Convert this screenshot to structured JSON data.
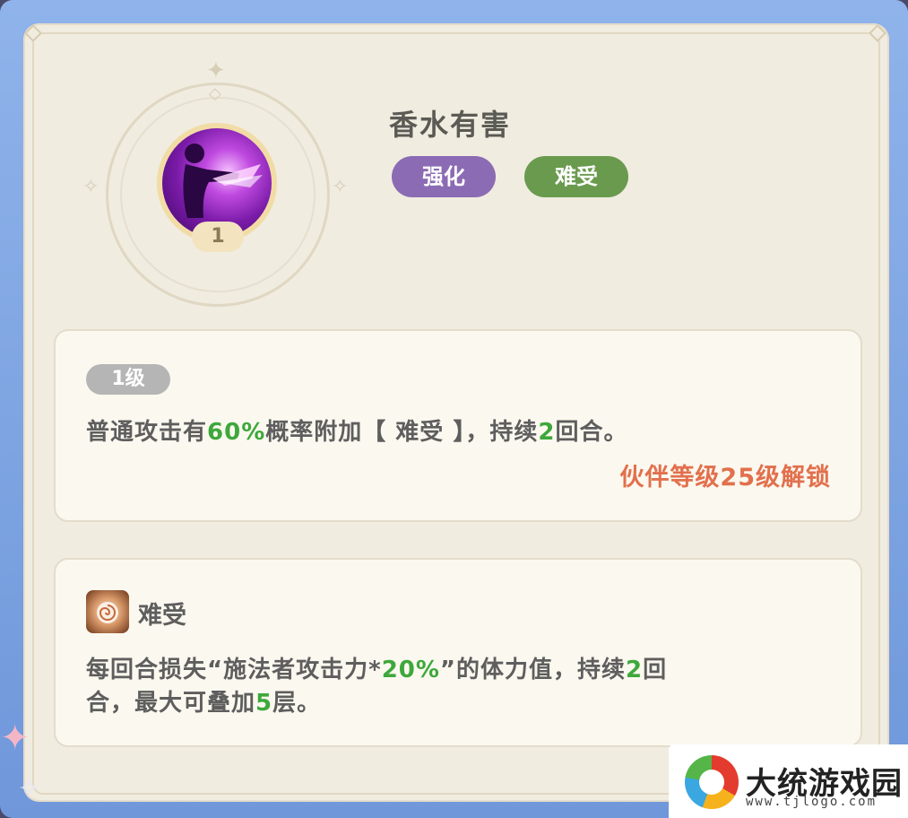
{
  "skill": {
    "name": "香水有害",
    "level_badge": "1",
    "tags": [
      "强化",
      "难受"
    ]
  },
  "level_panel": {
    "level_label": "1级",
    "description_parts": [
      "普通攻击有",
      "60%",
      "概率附加【 难受 】，持续",
      "2",
      "回合。"
    ],
    "unlock_text": "伙伴等级25级解锁"
  },
  "status_panel": {
    "icon": "debuff-swirl-icon",
    "name": "难受",
    "line1_parts": [
      "每回合损失“施法者攻击力*",
      "20%",
      "”的体力值，持续",
      "2",
      "回"
    ],
    "line2_parts": [
      "合，最大可叠加",
      "5",
      "层。"
    ]
  },
  "watermark": {
    "title": "大统游戏园",
    "url": "www.tjlogo.com"
  },
  "colors": {
    "highlight_green": "#3da83b",
    "unlock_orange": "#e2704d",
    "tag_purple": "#8b6bb3",
    "tag_green": "#6a9a4e",
    "frame_blue": "#7ea4e2"
  }
}
